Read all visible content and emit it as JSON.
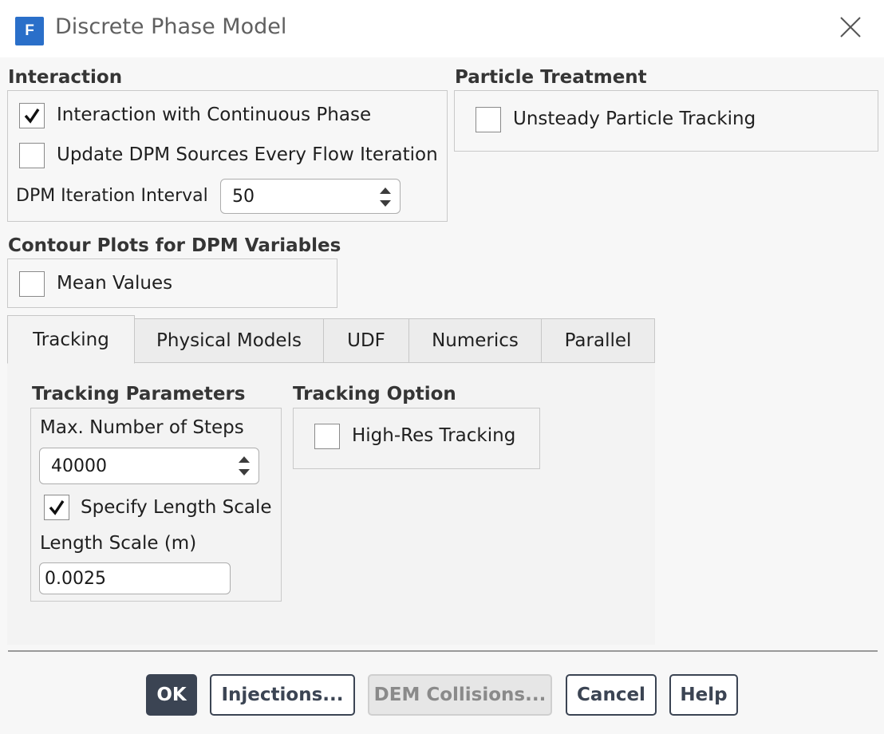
{
  "window": {
    "title": "Discrete Phase Model",
    "app_icon_letter": "F"
  },
  "interaction": {
    "title": "Interaction",
    "continuous_phase": {
      "label": "Interaction with Continuous Phase",
      "checked": true
    },
    "update_sources": {
      "label": "Update DPM Sources Every Flow Iteration",
      "checked": false
    },
    "iteration_interval": {
      "label": "DPM Iteration Interval",
      "value": "50"
    }
  },
  "particle_treatment": {
    "title": "Particle Treatment",
    "unsteady": {
      "label": "Unsteady Particle Tracking",
      "checked": false
    }
  },
  "contour_plots": {
    "title": "Contour Plots for DPM Variables",
    "mean_values": {
      "label": "Mean Values",
      "checked": false
    }
  },
  "tabs": [
    {
      "label": "Tracking",
      "active": true
    },
    {
      "label": "Physical Models",
      "active": false
    },
    {
      "label": "UDF",
      "active": false
    },
    {
      "label": "Numerics",
      "active": false
    },
    {
      "label": "Parallel",
      "active": false
    }
  ],
  "tracking": {
    "params_title": "Tracking Parameters",
    "max_steps_label": "Max. Number of Steps",
    "max_steps_value": "40000",
    "specify_length": {
      "label": "Specify Length Scale",
      "checked": true
    },
    "length_scale_label": "Length Scale (m)",
    "length_scale_value": "0.0025",
    "option_title": "Tracking Option",
    "high_res": {
      "label": "High-Res Tracking",
      "checked": false
    }
  },
  "buttons": {
    "ok": "OK",
    "injections": "Injections...",
    "dem_collisions": "DEM Collisions...",
    "cancel": "Cancel",
    "help": "Help"
  },
  "colors": {
    "accent": "#2a6fc9",
    "button_dark": "#3b4453"
  }
}
